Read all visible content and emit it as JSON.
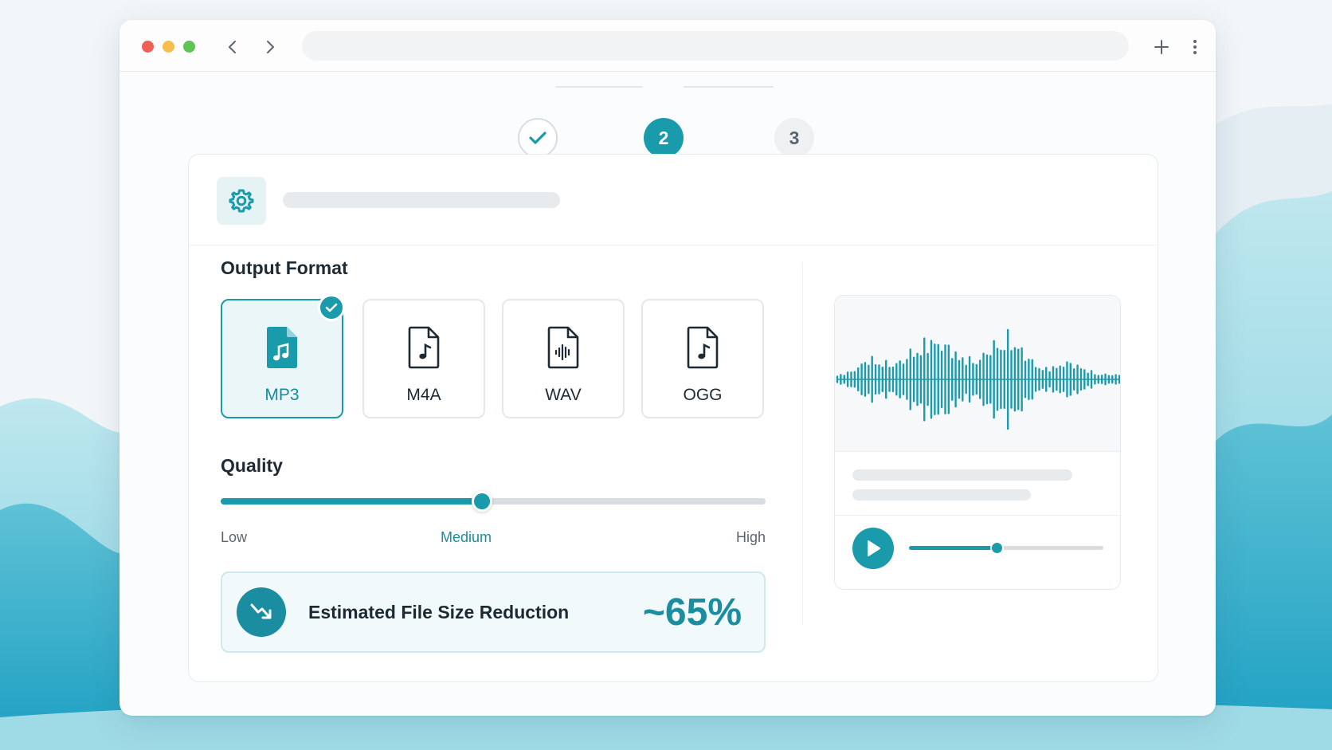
{
  "theme": {
    "accent": "#1a9bab",
    "accent_dark": "#1a8ea0"
  },
  "window": {
    "traffic_lights": [
      "#ed5f57",
      "#f5be4f",
      "#5fc454"
    ],
    "icons": {
      "back": "chevron-left-icon",
      "forward": "chevron-right-icon",
      "new_tab": "plus-icon",
      "menu": "kebab-menu-icon"
    }
  },
  "stepper": {
    "current": 2,
    "steps": [
      {
        "label": "",
        "state": "completed",
        "icon": "check-icon"
      },
      {
        "label": "2",
        "state": "active"
      },
      {
        "label": "3",
        "state": "upcoming"
      }
    ]
  },
  "card": {
    "header_icon": "gear-icon",
    "output_format": {
      "title": "Output Format",
      "selected": "MP3",
      "options": [
        {
          "label": "MP3",
          "icon": "music-file-icon",
          "selected": true
        },
        {
          "label": "M4A",
          "icon": "music-file-icon",
          "selected": false
        },
        {
          "label": "WAV",
          "icon": "waveform-file-icon",
          "selected": false
        },
        {
          "label": "OGG",
          "icon": "music-file-icon",
          "selected": false
        }
      ]
    },
    "quality": {
      "title": "Quality",
      "value_fraction": 0.48,
      "labels": {
        "low": "Low",
        "medium": "Medium",
        "high": "High"
      },
      "selected": "Medium"
    },
    "estimate": {
      "label": "Estimated File Size Reduction",
      "value": "~65%",
      "icon": "trend-down-icon"
    },
    "preview": {
      "icon": "play-icon",
      "playback_fraction": 0.45
    }
  }
}
